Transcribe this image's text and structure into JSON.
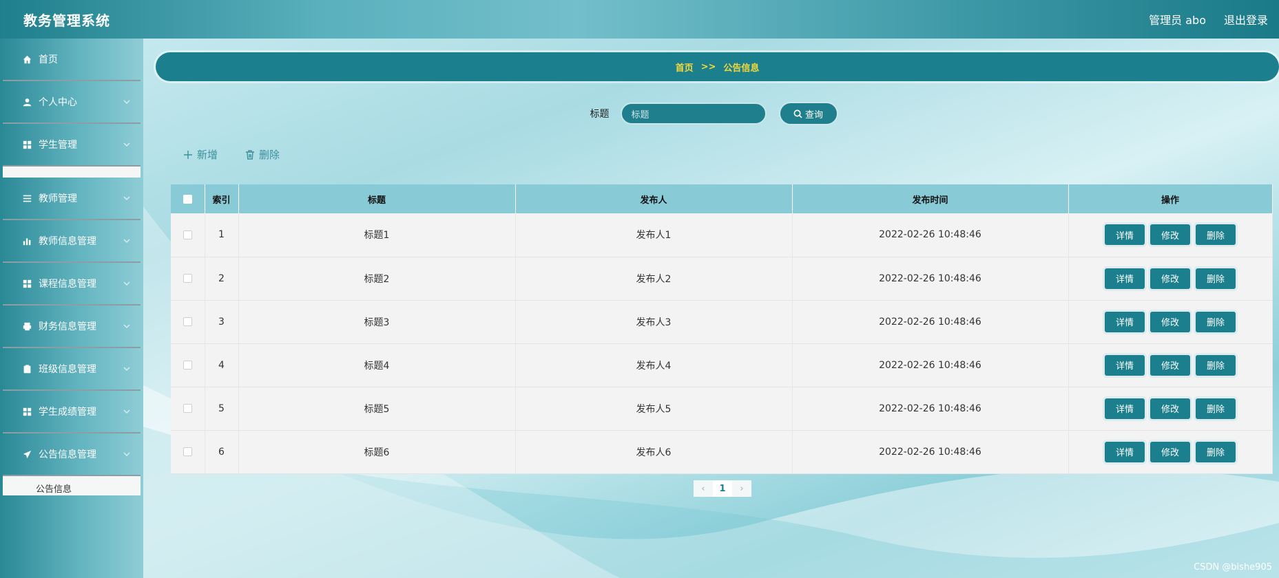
{
  "header": {
    "title": "教务管理系统",
    "user_label": "管理员 abo",
    "logout_label": "退出登录"
  },
  "sidebar": {
    "items": [
      {
        "label": "首页",
        "icon": "home-icon"
      },
      {
        "label": "个人中心",
        "icon": "user-icon"
      },
      {
        "label": "学生管理",
        "icon": "grid-icon"
      },
      {
        "label": "教师管理",
        "icon": "list-icon"
      },
      {
        "label": "教师信息管理",
        "icon": "bar-chart-icon"
      },
      {
        "label": "课程信息管理",
        "icon": "grid-icon"
      },
      {
        "label": "财务信息管理",
        "icon": "printer-icon"
      },
      {
        "label": "班级信息管理",
        "icon": "clipboard-icon"
      },
      {
        "label": "学生成绩管理",
        "icon": "grid-icon"
      },
      {
        "label": "公告信息管理",
        "icon": "send-icon"
      }
    ],
    "sub_item_active": "公告信息"
  },
  "breadcrumb": {
    "home": "首页",
    "separator": ">>",
    "current": "公告信息"
  },
  "search": {
    "label": "标题",
    "placeholder": "标题",
    "button_label": "查询"
  },
  "actions": {
    "add_label": "新增",
    "delete_label": "删除"
  },
  "table": {
    "headers": [
      "索引",
      "标题",
      "发布人",
      "发布时间",
      "操作"
    ],
    "rows": [
      {
        "index": "1",
        "title": "标题1",
        "publisher": "发布人1",
        "time": "2022-02-26 10:48:46"
      },
      {
        "index": "2",
        "title": "标题2",
        "publisher": "发布人2",
        "time": "2022-02-26 10:48:46"
      },
      {
        "index": "3",
        "title": "标题3",
        "publisher": "发布人3",
        "time": "2022-02-26 10:48:46"
      },
      {
        "index": "4",
        "title": "标题4",
        "publisher": "发布人4",
        "time": "2022-02-26 10:48:46"
      },
      {
        "index": "5",
        "title": "标题5",
        "publisher": "发布人5",
        "time": "2022-02-26 10:48:46"
      },
      {
        "index": "6",
        "title": "标题6",
        "publisher": "发布人6",
        "time": "2022-02-26 10:48:46"
      }
    ],
    "row_actions": {
      "detail": "详情",
      "edit": "修改",
      "delete": "删除"
    }
  },
  "pagination": {
    "current_page": "1"
  },
  "watermark": "CSDN @bishe905",
  "colors": {
    "primary": "#1c7f8d",
    "breadcrumb_text": "#f5d93a",
    "table_header": "#88cbd7"
  }
}
